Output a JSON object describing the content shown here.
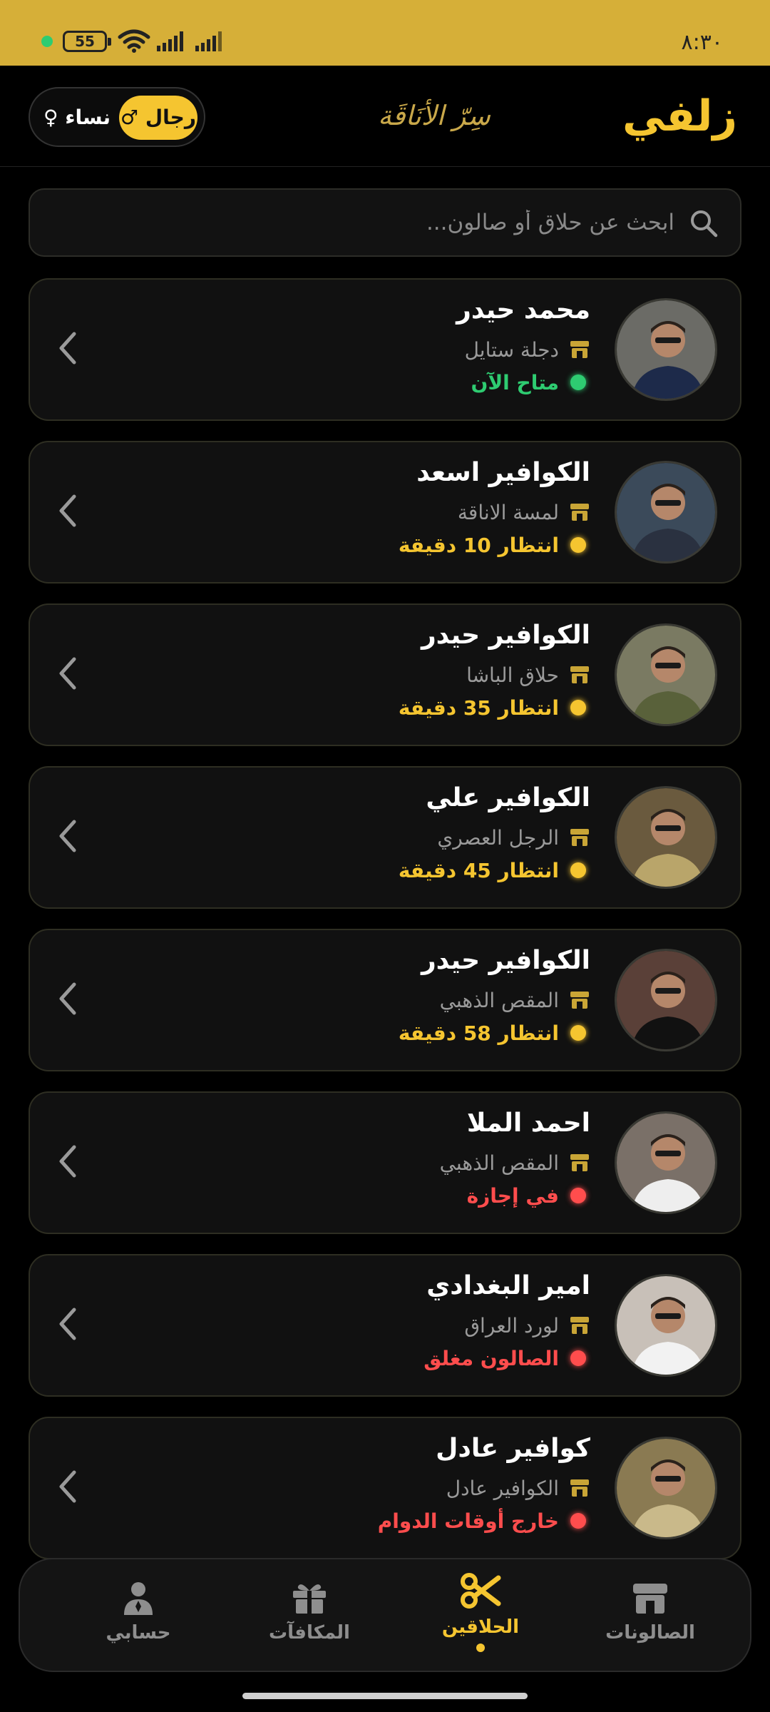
{
  "status_bar": {
    "time": "٨:٣٠",
    "battery": "55"
  },
  "header": {
    "brand": "زلفي",
    "tagline": "سِرّ الأنَاقَة",
    "gender_men": "رجال ♂",
    "gender_women": "نساء ♀"
  },
  "search": {
    "placeholder": "ابحث عن حلاق أو صالون..."
  },
  "barbers": [
    {
      "name": "محمد حيدر",
      "salon": "دجلة ستايل",
      "status": "متاح الآن",
      "status_color": "#2ecc71"
    },
    {
      "name": "الكوافير اسعد",
      "salon": "لمسة الاناقة",
      "status": "انتظار 10 دقيقة",
      "status_color": "#f5c530"
    },
    {
      "name": "الكوافير حيدر",
      "salon": "حلاق الباشا",
      "status": "انتظار 35 دقيقة",
      "status_color": "#f5c530"
    },
    {
      "name": "الكوافير علي",
      "salon": "الرجل العصري",
      "status": "انتظار 45 دقيقة",
      "status_color": "#f5c530"
    },
    {
      "name": "الكوافير حيدر",
      "salon": "المقص الذهبي",
      "status": "انتظار 58 دقيقة",
      "status_color": "#f5c530"
    },
    {
      "name": "احمد الملا",
      "salon": "المقص الذهبي",
      "status": "في إجازة",
      "status_color": "#ff4d4d"
    },
    {
      "name": "امير البغدادي",
      "salon": "لورد العراق",
      "status": "الصالون مغلق",
      "status_color": "#ff4d4d"
    },
    {
      "name": "كوافير عادل",
      "salon": "الكوافير عادل",
      "status": "خارج أوقات الدوام",
      "status_color": "#ff4d4d"
    }
  ],
  "bottom_nav": {
    "salons": "الصالونات",
    "barbers": "الحلاقين",
    "rewards": "المكافآت",
    "account": "حسابي"
  },
  "colors": {
    "accent": "#f5c530",
    "status_bar": "#d6af38",
    "available": "#2ecc71",
    "wait": "#f5c530",
    "closed": "#ff4d4d"
  }
}
